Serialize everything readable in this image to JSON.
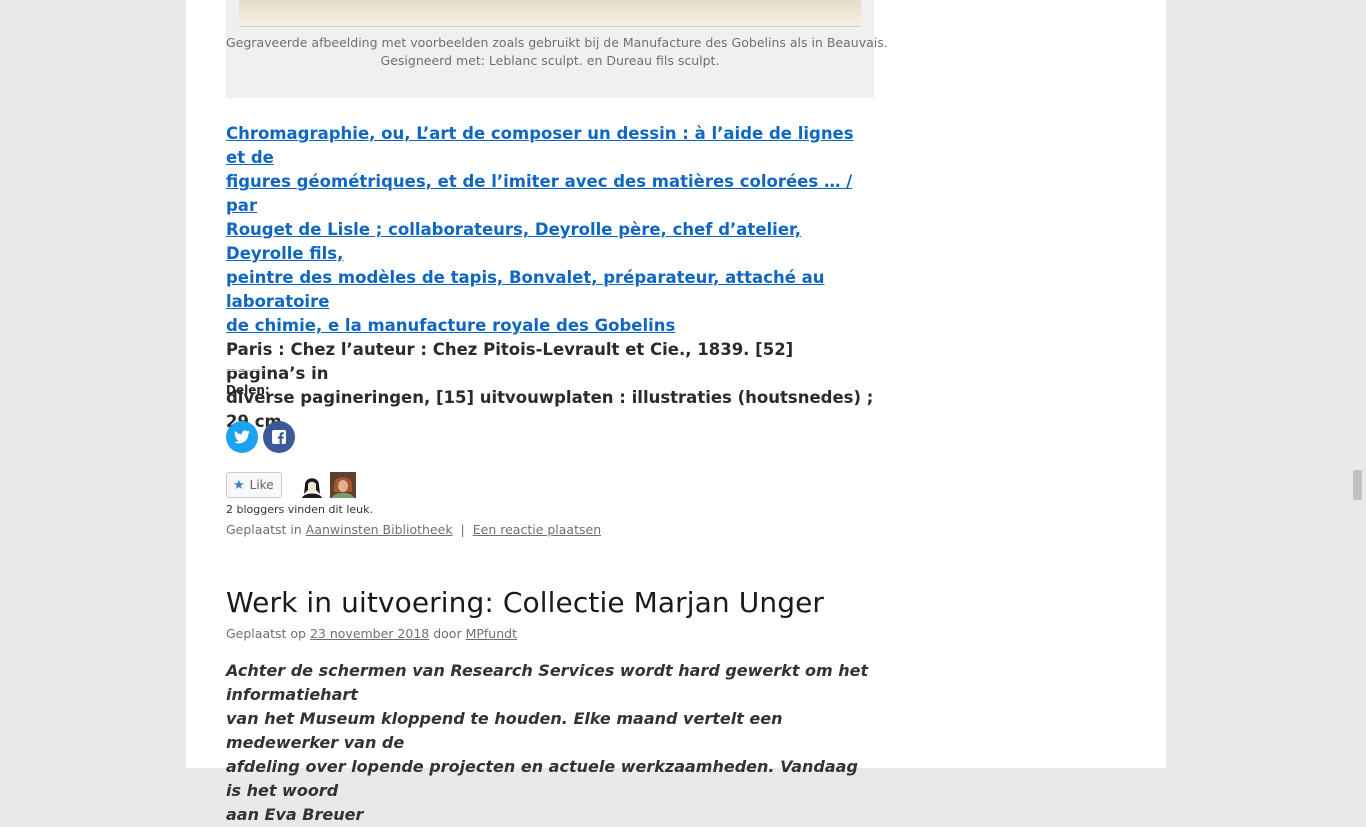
{
  "figure": {
    "caption_line1": "Gegraveerde afbeelding met voorbeelden zoals gebruikt bij de Manufacture des Gobelins als in Beauvais.",
    "caption_line2": "Gesigneerd met: Leblanc sculpt. en Dureau fils sculpt."
  },
  "book": {
    "title_lines": [
      "Chromagraphie, ou, L’art de composer un dessin : à l’aide de lignes et de",
      "figures géométriques, et de l’imiter avec des matières colorées … / par",
      "Rouget de Lisle ; collaborateurs, Deyrolle père, chef d’atelier, Deyrolle fils,",
      "peintre des modèles de tapis, Bonvalet, préparateur, attaché au laboratoire",
      "de chimie, e la manufacture royale des Gobelins"
    ],
    "imprint_lines": [
      "Paris : Chez l’auteur : Chez Pitois-Levrault et Cie., 1839. [52] pagina’s in",
      "diverse pagineringen, [15] uitvouwplaten : illustraties (houtsnedes) ; 29 cm."
    ]
  },
  "share": {
    "label": "Delen:"
  },
  "like": {
    "button_label": "Like",
    "count_text": "2 bloggers vinden dit leuk."
  },
  "posted_in": {
    "prefix": "Geplaatst in",
    "category": "Aanwinsten Bibliotheek",
    "separator": "|",
    "comment_link": "Een reactie plaatsen"
  },
  "next_post": {
    "title": "Werk in uitvoering: Collectie Marjan Unger",
    "meta_prefix": "Geplaatst op",
    "date": "23 november 2018",
    "meta_by": "door",
    "author": "MPfundt",
    "excerpt_lines": [
      "Achter de schermen van Research Services wordt hard gewerkt om het informatiehart",
      "van het Museum kloppend te houden. Elke maand vertelt een medewerker van de",
      "afdeling over lopende projecten en actuele werkzaamheden. Vandaag is het woord",
      "aan Eva Breuer"
    ]
  },
  "colors": {
    "link_blue": "#0f67c4",
    "twitter": "#1da1f2",
    "facebook": "#3b5998"
  }
}
